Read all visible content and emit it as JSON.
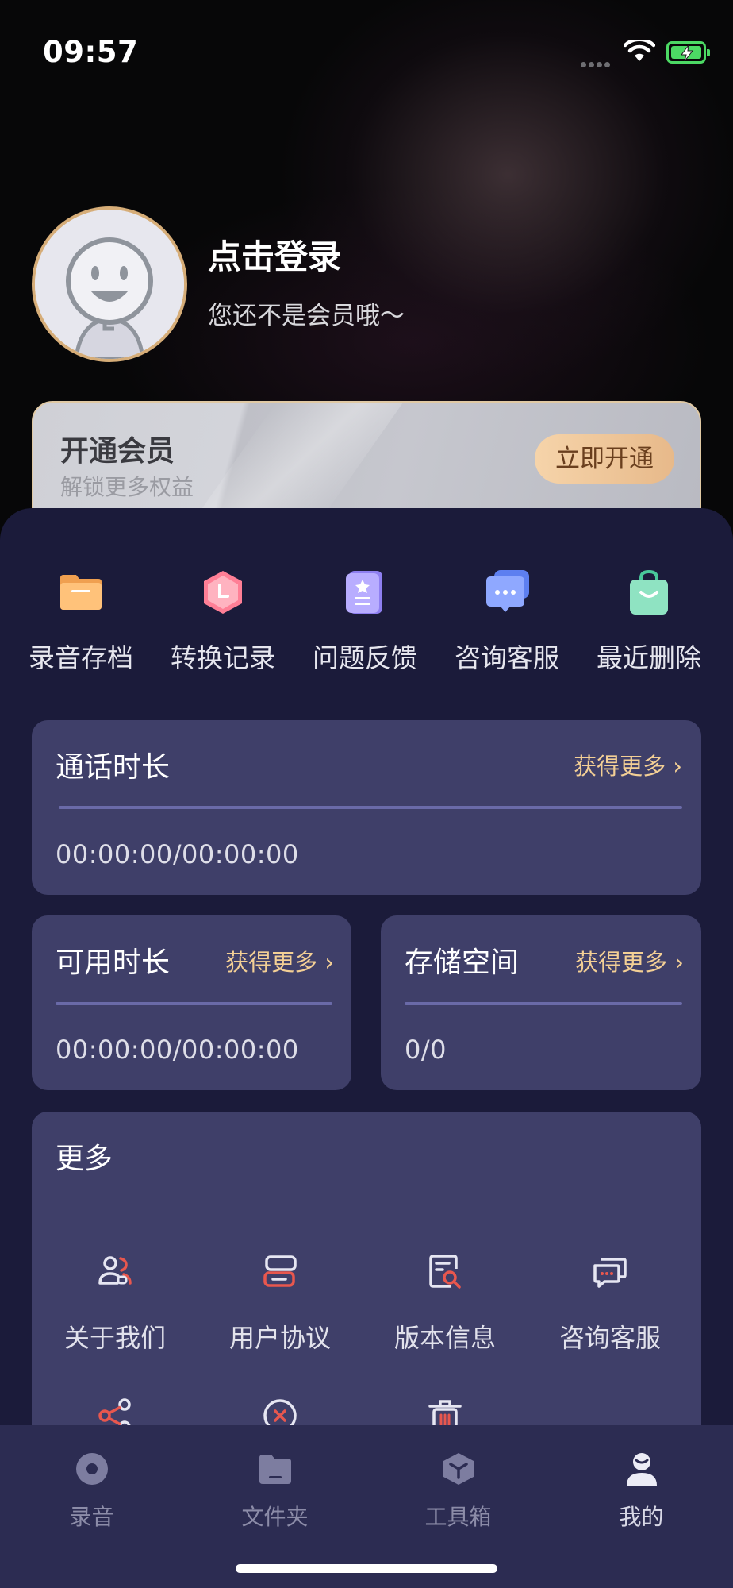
{
  "status_bar": {
    "time": "09:57"
  },
  "profile": {
    "login_text": "点击登录",
    "member_status": "您还不是会员哦～"
  },
  "vip_card": {
    "title": "开通会员",
    "subtitle": "解锁更多权益",
    "button": "立即开通"
  },
  "quick_actions": [
    {
      "label": "录音存档",
      "icon": "folder-icon"
    },
    {
      "label": "转换记录",
      "icon": "clock-hexagon-icon"
    },
    {
      "label": "问题反馈",
      "icon": "feedback-icon"
    },
    {
      "label": "咨询客服",
      "icon": "chat-bubble-icon"
    },
    {
      "label": "最近删除",
      "icon": "bag-icon"
    }
  ],
  "call_duration": {
    "title": "通话时长",
    "more": "获得更多",
    "value": "00:00:00/00:00:00"
  },
  "available_duration": {
    "title": "可用时长",
    "more": "获得更多",
    "value": "00:00:00/00:00:00"
  },
  "storage": {
    "title": "存储空间",
    "more": "获得更多",
    "value": "0/0"
  },
  "more_section": {
    "title": "更多",
    "items": [
      {
        "label": "关于我们",
        "icon": "users-icon"
      },
      {
        "label": "用户协议",
        "icon": "agreement-icon"
      },
      {
        "label": "版本信息",
        "icon": "version-search-icon"
      },
      {
        "label": "咨询客服",
        "icon": "chat-icon"
      },
      {
        "label": "",
        "icon": "share-icon"
      },
      {
        "label": "",
        "icon": "close-circle-icon"
      },
      {
        "label": "",
        "icon": "trash-icon"
      }
    ]
  },
  "tabbar": {
    "active": "我的",
    "items": [
      {
        "label": "录音",
        "icon": "record-icon"
      },
      {
        "label": "文件夹",
        "icon": "folder-tab-icon"
      },
      {
        "label": "工具箱",
        "icon": "toolbox-icon"
      },
      {
        "label": "我的",
        "icon": "profile-icon"
      }
    ]
  },
  "colors": {
    "accent_gold": "#f3cf95",
    "panel": "#1b1b3a",
    "card": "#3f3f69",
    "tabbar": "#2c2c52"
  }
}
